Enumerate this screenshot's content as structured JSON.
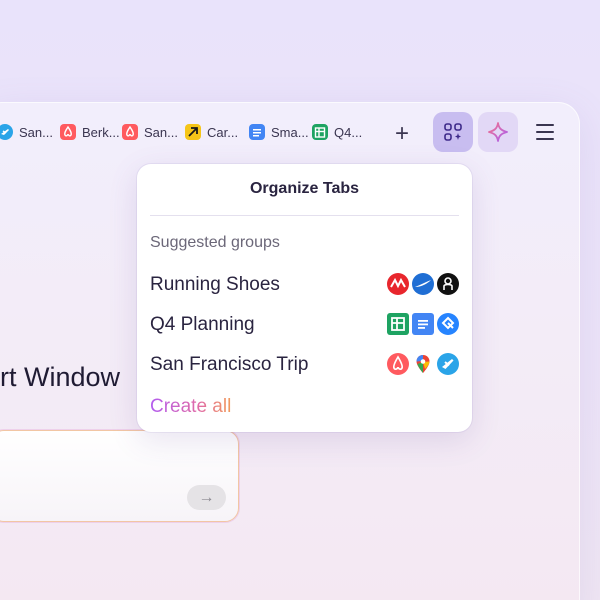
{
  "tabs": [
    {
      "label": "San...",
      "icon": "airplane-icon",
      "color": "#2aa4e8"
    },
    {
      "label": "Berk...",
      "icon": "airbnb-icon",
      "color": "#ff5a5f"
    },
    {
      "label": "San...",
      "icon": "airbnb-icon",
      "color": "#ff5a5f"
    },
    {
      "label": "Car...",
      "icon": "arrow-icon",
      "color": "#f5c518"
    },
    {
      "label": "Sma...",
      "icon": "docs-icon",
      "color": "#4285f4"
    },
    {
      "label": "Q4...",
      "icon": "sheets-icon",
      "color": "#1ea362"
    }
  ],
  "toolbar": {
    "new_tab_label": "+",
    "organize_icon": "organize-tabs-icon",
    "ai_icon": "sparkle-icon",
    "menu_icon": "hamburger-menu-icon"
  },
  "main": {
    "heading_fragment": "rt Window",
    "send_icon": "→"
  },
  "popup": {
    "title": "Organize Tabs",
    "subtitle": "Suggested groups",
    "groups": [
      {
        "name": "Running Shoes",
        "icons": [
          "new-balance-icon",
          "brooks-icon",
          "on-running-icon"
        ]
      },
      {
        "name": "Q4 Planning",
        "icons": [
          "sheets-icon",
          "docs-icon",
          "jira-icon"
        ]
      },
      {
        "name": "San Francisco Trip",
        "icons": [
          "airbnb-icon",
          "maps-pin-icon",
          "airplane-icon"
        ]
      }
    ],
    "create_all_label": "Create all"
  },
  "colors": {
    "accent_purple": "#c8bdf0",
    "create_all_gradient": [
      "#b25df0",
      "#e06aa7",
      "#f29a5a"
    ]
  }
}
